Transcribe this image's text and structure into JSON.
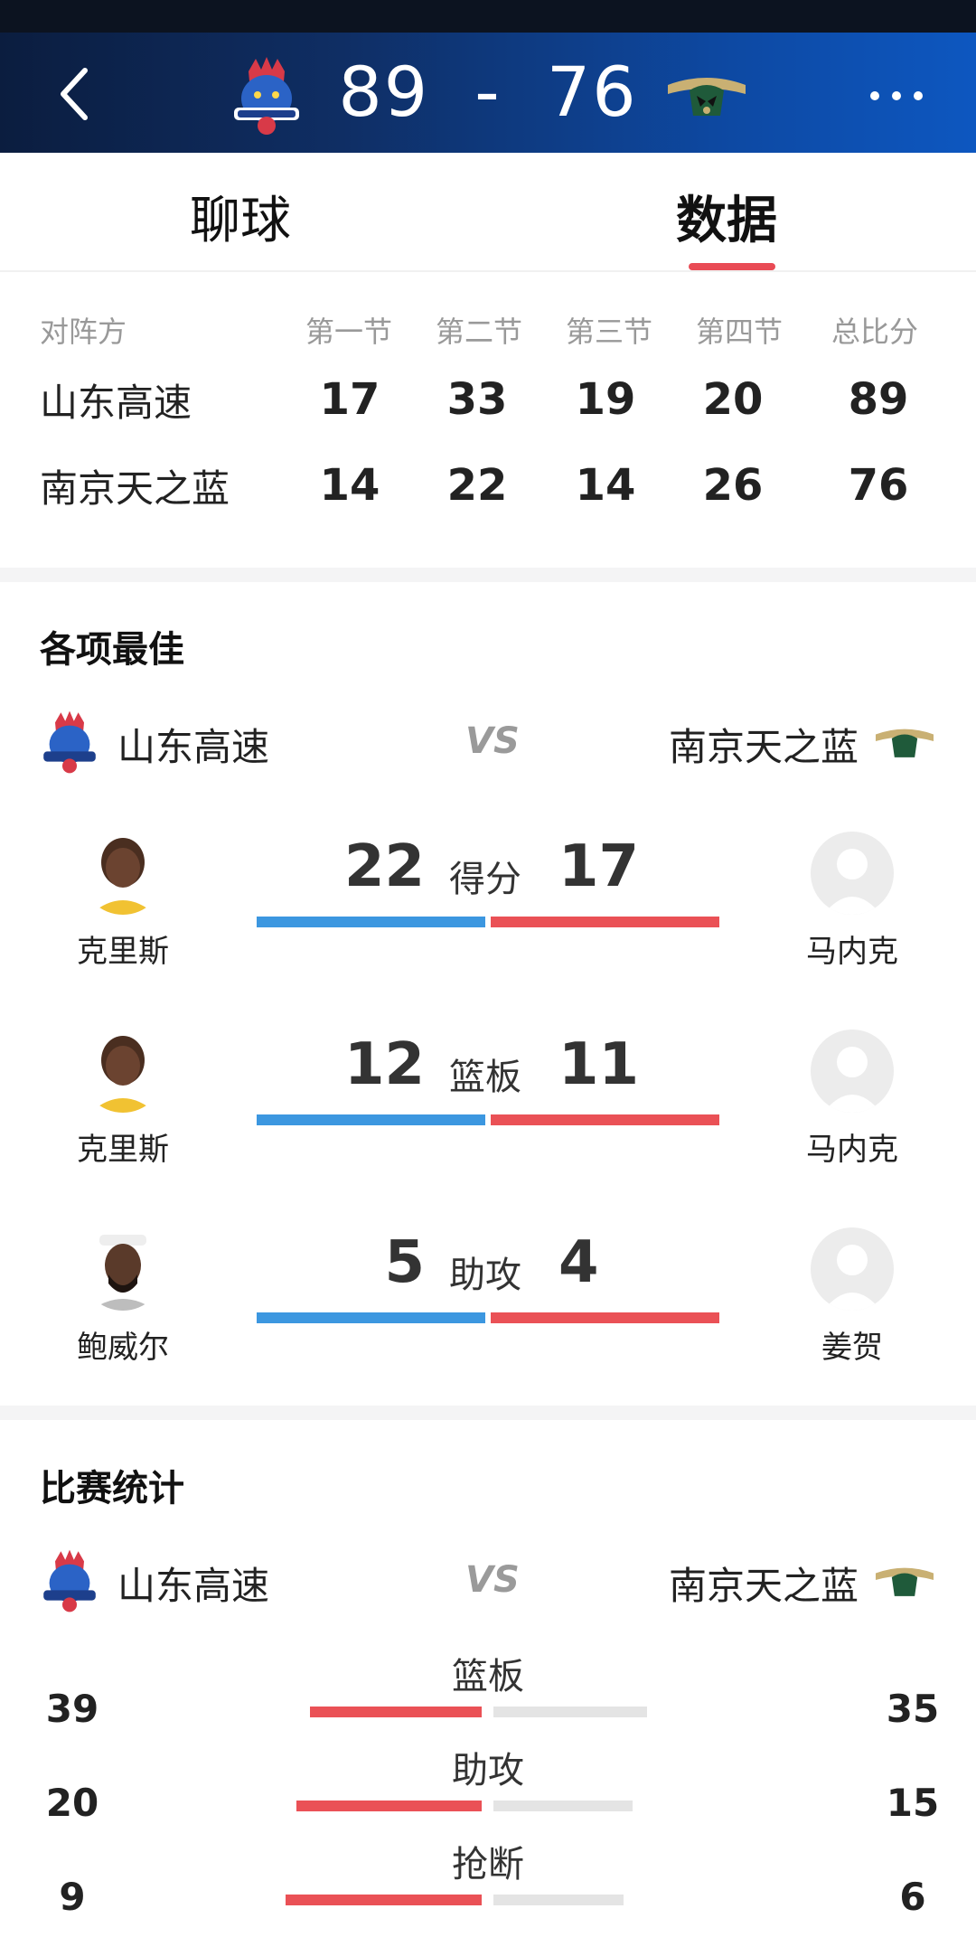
{
  "header": {
    "score_home": "89",
    "score_sep": "-",
    "score_away": "76"
  },
  "tabs": {
    "chat": "聊球",
    "data": "数据"
  },
  "quarters": {
    "headers": [
      "对阵方",
      "第一节",
      "第二节",
      "第三节",
      "第四节",
      "总比分"
    ],
    "rows": [
      {
        "team": "山东高速",
        "scores": [
          "17",
          "33",
          "19",
          "20",
          "89"
        ]
      },
      {
        "team": "南京天之蓝",
        "scores": [
          "14",
          "22",
          "14",
          "26",
          "76"
        ]
      }
    ]
  },
  "best": {
    "title": "各项最佳",
    "home_team": "山东高速",
    "vs": "VS",
    "away_team": "南京天之蓝",
    "items": [
      {
        "label": "得分",
        "home_value": "22",
        "away_value": "17",
        "home_player": "克里斯",
        "away_player": "马内克"
      },
      {
        "label": "篮板",
        "home_value": "12",
        "away_value": "11",
        "home_player": "克里斯",
        "away_player": "马内克"
      },
      {
        "label": "助攻",
        "home_value": "5",
        "away_value": "4",
        "home_player": "鲍威尔",
        "away_player": "姜贺"
      }
    ]
  },
  "stats": {
    "title": "比赛统计",
    "home_team": "山东高速",
    "vs": "VS",
    "away_team": "南京天之蓝",
    "items": [
      {
        "label": "篮板",
        "home": "39",
        "away": "35"
      },
      {
        "label": "助攻",
        "home": "20",
        "away": "15"
      },
      {
        "label": "抢断",
        "home": "9",
        "away": "6"
      }
    ]
  },
  "colors": {
    "home_bar": "#3c97e0",
    "away_bar": "#ea5156",
    "accent": "#e94b55"
  }
}
